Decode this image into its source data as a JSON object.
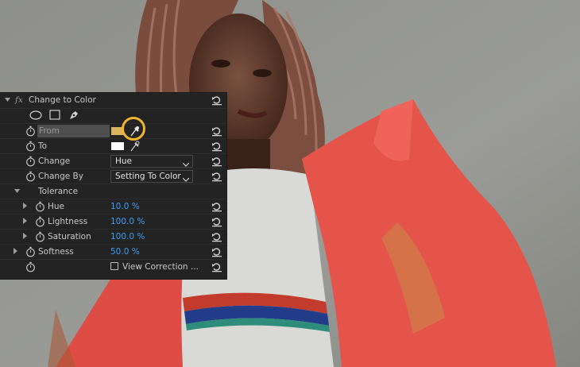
{
  "effect": {
    "fx_label": "fx",
    "name": "Change to Color"
  },
  "rows": {
    "from": {
      "label": "From",
      "color": "#d8b460"
    },
    "to": {
      "label": "To",
      "color": "#ffffff"
    },
    "change": {
      "label": "Change",
      "value": "Hue"
    },
    "change_by": {
      "label": "Change By",
      "value": "Setting To Color"
    },
    "tolerance": {
      "label": "Tolerance"
    },
    "hue": {
      "label": "Hue",
      "value": "10.0 %"
    },
    "lightness": {
      "label": "Lightness",
      "value": "100.0 %"
    },
    "saturation": {
      "label": "Saturation",
      "value": "100.0 %"
    },
    "softness": {
      "label": "Softness",
      "value": "50.0 %"
    },
    "view_correction": {
      "label": "View Correction ...",
      "checked": false
    }
  },
  "icons": {
    "mask_tools": [
      "ellipse-mask-icon",
      "rectangle-mask-icon",
      "pen-mask-icon"
    ],
    "stopwatch": "stopwatch-icon",
    "reset": "reset-parameter-icon",
    "eyedropper": "eyedropper-icon"
  },
  "colors": {
    "highlight_ring": "#f0b52a",
    "value_blue": "#3d9ef7",
    "panel_bg": "#232323"
  }
}
